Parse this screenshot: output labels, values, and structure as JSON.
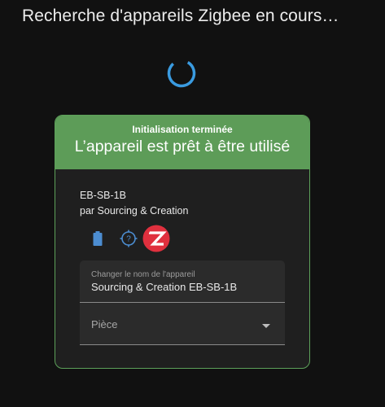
{
  "title": "Recherche d'appareils Zigbee en cours…",
  "card": {
    "header_sub": "Initialisation terminée",
    "header_main": "L’appareil est prêt à être utilisé",
    "device_name": "EB-SB-1B",
    "device_maker": "par Sourcing & Creation",
    "icons": [
      "battery-icon",
      "help-circle-icon",
      "zigbee-logo-icon"
    ],
    "rename_field": {
      "label": "Changer le nom de l'appareil",
      "value": "Sourcing & Creation EB-SB-1B"
    },
    "room_field": {
      "placeholder": "Pièce"
    }
  },
  "colors": {
    "background": "#111111",
    "card_bg": "#1f1f1f",
    "success_green": "#5d9c58",
    "spinner_blue": "#3a9be0",
    "icon_blue": "#4c8dd1",
    "zigbee_red": "#e0303e"
  }
}
